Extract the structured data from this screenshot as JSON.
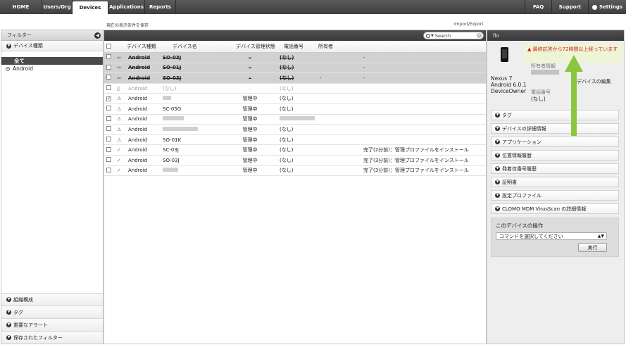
{
  "nav": {
    "tabs": [
      "HOME",
      "Users/Org",
      "Devices",
      "Applications",
      "Reports"
    ],
    "right_tabs": [
      "FAQ",
      "Support",
      "Settings"
    ],
    "active": "Devices"
  },
  "toolbar": {
    "save_conditions": "現在の表示条件を保存",
    "import_export": "Import/Export",
    "search_placeholder": "Search"
  },
  "sidebar": {
    "header": "フィルター",
    "section": "デバイス種類",
    "items": [
      "全て",
      "Android"
    ],
    "bottom": [
      "組織構成",
      "タグ",
      "重要なアラート",
      "保存されたフィルター"
    ]
  },
  "table": {
    "headers": [
      "デバイス種類",
      "デバイス名",
      "デバイス管理状態",
      "電話番号",
      "所有者"
    ],
    "rows": [
      {
        "type": "Android",
        "name": "SO-03J",
        "state": "–",
        "phone": "(なし)",
        "owner": "",
        "status": "-"
      },
      {
        "type": "Android",
        "name": "SO-01J",
        "state": "–",
        "phone": "(なし)",
        "owner": "",
        "status": "-"
      },
      {
        "type": "Android",
        "name": "SO-03J",
        "state": "–",
        "phone": "(なし)",
        "owner": "-",
        "status": "-"
      },
      {
        "type": "Android",
        "name": "(なし)",
        "state": "–",
        "phone": "(なし)",
        "owner": "",
        "status": ""
      },
      {
        "type": "Android",
        "name": "",
        "state": "管理中",
        "phone": "(なし)",
        "owner": "",
        "status": ""
      },
      {
        "type": "Android",
        "name": "SC-05G",
        "state": "管理中",
        "phone": "(なし)",
        "owner": "",
        "status": ""
      },
      {
        "type": "Android",
        "name": "",
        "state": "管理中",
        "phone": "",
        "owner": "",
        "status": ""
      },
      {
        "type": "Android",
        "name": "",
        "state": "管理中",
        "phone": "(なし)",
        "owner": "",
        "status": ""
      },
      {
        "type": "Android",
        "name": "SO-01K",
        "state": "管理中",
        "phone": "(なし)",
        "owner": "",
        "status": ""
      },
      {
        "type": "Android",
        "name": "SC-03J",
        "state": "管理中",
        "phone": "(なし)",
        "owner": "",
        "status": "完了(2分前)：管理プロファイルをインストール"
      },
      {
        "type": "Android",
        "name": "SO-03J",
        "state": "管理中",
        "phone": "(なし)",
        "owner": "",
        "status": "完了(3分前)：管理プロファイルをインストール"
      },
      {
        "type": "Android",
        "name": "",
        "state": "管理中",
        "phone": "(なし)",
        "owner": "",
        "status": "完了(3分前)：管理プロファイルをインストール"
      }
    ]
  },
  "detail": {
    "title": "flo",
    "alert": "最終応答から72時間以上経っています",
    "model": "Nexus 7",
    "os": "Android 6.0.1",
    "mode": "DeviceOwner",
    "owner_label": "所有者情報",
    "edit_link": "デバイスの編集",
    "phone_label": "電話番号",
    "phone_value": "(なし)",
    "sections": [
      "タグ",
      "デバイスの詳細情報",
      "アプリケーション",
      "位置情報履歴",
      "発着信番号履歴",
      "証明書",
      "設定プロファイル",
      "CLOMO MDM VirusScan の詳細情報"
    ],
    "ops_title": "このデバイスの操作",
    "command_placeholder": "コマンドを選択してください",
    "run_button": "実行"
  },
  "colors": {
    "accent_arrow": "#8cc63f",
    "alert_text": "#d42020",
    "alert_bg": "#eef5d4"
  }
}
